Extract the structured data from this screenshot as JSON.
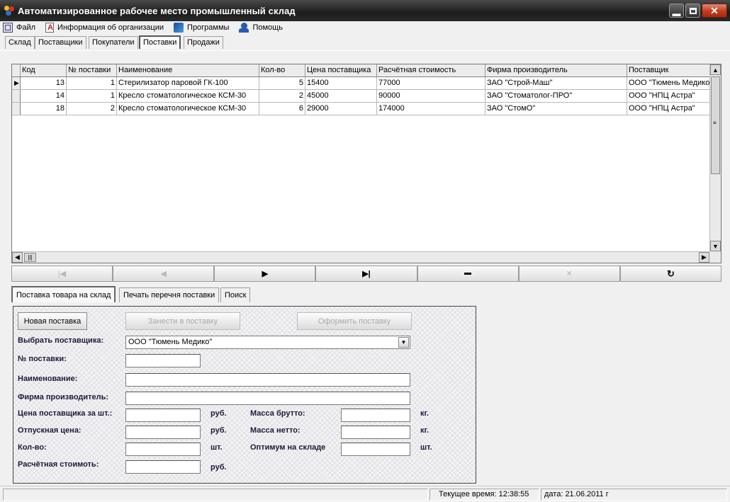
{
  "window": {
    "title": "Автоматизированное рабочее место промышленный склад"
  },
  "menu": [
    {
      "label": "Файл",
      "icon": "file-icon"
    },
    {
      "label": "Информация об организации",
      "icon": "document-icon"
    },
    {
      "label": "Программы",
      "icon": "programs-icon"
    },
    {
      "label": "Помощь",
      "icon": "help-icon"
    }
  ],
  "main_tabs": [
    "Склад",
    "Поставщики",
    "Покупатели",
    "Поставки",
    "Продажи"
  ],
  "active_main_tab": "Поставки",
  "grid": {
    "columns": [
      "Код",
      "№ поставки",
      "Наименование",
      "Кол-во",
      "Цена поставщика",
      "Расчётная стоимость",
      "Фирма производитель",
      "Поставщик"
    ],
    "rows": [
      [
        "13",
        "1",
        "Стерилизатор паровой ГК-100",
        "5",
        "15400",
        "77000",
        "ЗАО \"Строй-Маш\"",
        "ООО \"Тюмень Медико\""
      ],
      [
        "14",
        "1",
        "Кресло стоматологическое КСМ-30",
        "2",
        "45000",
        "90000",
        "ЗАО \"Стоматолог-ПРО\"",
        "ООО \"НПЦ Астра\""
      ],
      [
        "18",
        "2",
        "Кресло стоматологическое КСМ-30",
        "6",
        "29000",
        "174000",
        "ЗАО \"СтомО\"",
        "ООО \"НПЦ Астра\""
      ]
    ],
    "selected_row": 0
  },
  "navigator": [
    {
      "name": "first",
      "glyph": "⏮",
      "enabled": false
    },
    {
      "name": "prior",
      "glyph": "◀",
      "enabled": false
    },
    {
      "name": "next",
      "glyph": "▶",
      "enabled": true
    },
    {
      "name": "last",
      "glyph": "▶|",
      "enabled": true
    },
    {
      "name": "delete",
      "glyph": "━",
      "enabled": true
    },
    {
      "name": "cancel",
      "glyph": "✕",
      "enabled": false
    },
    {
      "name": "refresh",
      "glyph": "↻",
      "enabled": true
    }
  ],
  "sub_tabs": [
    "Поставка товара на склад",
    "Печать перечня поставки",
    "Поиск"
  ],
  "form": {
    "new_button": "Новая поставка",
    "add_button": "Занести в поставку",
    "finish_button": "Оформить поставку",
    "supplier_label": "Выбрать поставщика:",
    "supplier_value": "ООО \"Тюмень Медико\"",
    "delivery_no_label": "№ поставки:",
    "name_label": "Наименование:",
    "manufacturer_label": "Фирма производитель:",
    "price_label": "Цена поставщика за шт.:",
    "sale_price_label": "Отпускная цена:",
    "qty_label": "Кол-во:",
    "total_label": "Расчётная стоимоть:",
    "gross_label": "Масса брутто:",
    "net_label": "Масса нетто:",
    "optimum_label": "Оптимум на складе",
    "unit_rub": "руб.",
    "unit_kg": "кг.",
    "unit_pcs": "шт."
  },
  "status": {
    "time_label": "Текущее время: 12:38:55",
    "date_label": "дата: 21.06.2011 г"
  }
}
